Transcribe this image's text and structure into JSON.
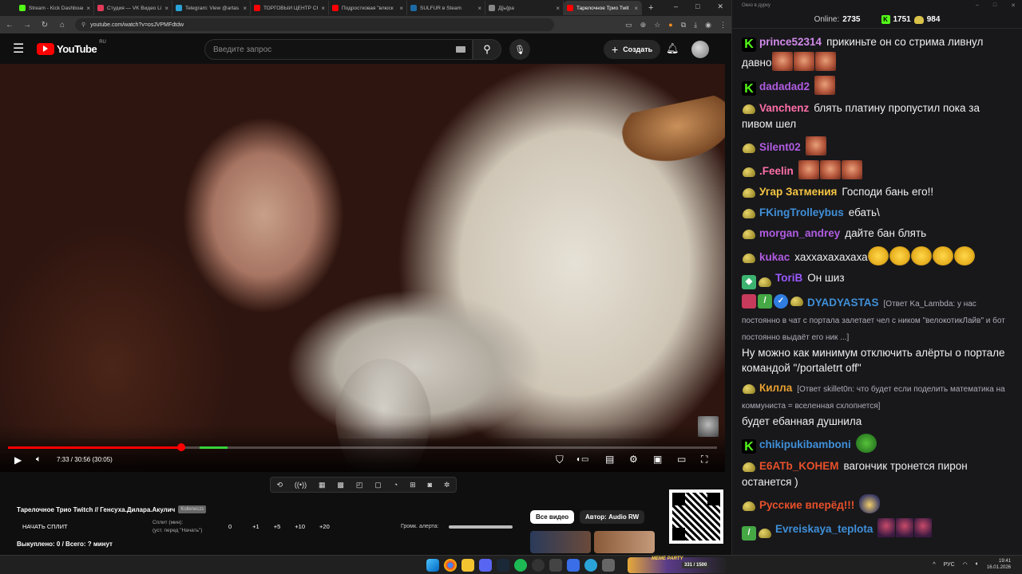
{
  "browser": {
    "tabs": [
      {
        "title": "Stream - Kick Dashboard",
        "color": "#53fc18"
      },
      {
        "title": "Студия — VK Видео Live",
        "color": "#e33a5a"
      },
      {
        "title": "Telegram: View @artas",
        "color": "#2aa3d8"
      },
      {
        "title": "ТОРГОВЫЙ ЦЕНТР СКА",
        "color": "#ff0000"
      },
      {
        "title": "Подростковая \"влюск",
        "color": "#ff0000"
      },
      {
        "title": "SULFUR в Steam",
        "color": "#1b6aa5"
      },
      {
        "title": "Д[ы]ра",
        "color": "#888888"
      },
      {
        "title": "Тарелочное Трио Twit",
        "color": "#ff0000",
        "active": true
      }
    ],
    "url": "youtube.com/watch?v=osJVPMFdtdw"
  },
  "youtube": {
    "logo_text": "YouTube",
    "region": "RU",
    "search_placeholder": "Введите запрос",
    "create_label": "Создать",
    "player": {
      "time": "7:33 / 30:56 (30:05)",
      "progress_fraction": 0.244,
      "buffered_start": 0.27,
      "buffered_end": 0.31
    },
    "video_title": "Тарелочное Трио Twitch // Генсуха.Дилара.Акулич",
    "title_tag": "Kolleneczs",
    "split_button": "НАЧАТЬ СПЛИТ",
    "split_label_1": "Сплит (мин):",
    "split_label_2": "(уст. перед \"Начать\")",
    "split_values": [
      "0",
      "+1",
      "+5",
      "+10",
      "+20"
    ],
    "alert_volume_label": "Громк. алерта:",
    "bought_text": "Выкуплено: 0 / Всего: ? минут",
    "chip_all": "Все видео",
    "chip_author": "Автор: Audio RW"
  },
  "chat": {
    "window_title": "Окно в дурку",
    "online_label": "Online:",
    "online_count": "2735",
    "kick_count": "1751",
    "twitch_count": "984",
    "messages": [
      {
        "badges": [
          "kick"
        ],
        "user": "prince52314",
        "color": "#d08ae8",
        "text": "прикиньте он со стрима ливнул давно",
        "emotes": [
          "face",
          "face",
          "face"
        ]
      },
      {
        "badges": [
          "kick"
        ],
        "user": "dadadad2",
        "color": "#b05ce0",
        "text": "",
        "emotes": [
          "face"
        ]
      },
      {
        "badges": [
          "toad"
        ],
        "user": "Vanchenz",
        "color": "#ff6fa8",
        "text": "блять платину пропустил пока за пивом шел",
        "emotes": []
      },
      {
        "badges": [
          "toad"
        ],
        "user": "Silent02",
        "color": "#b05ce0",
        "text": "",
        "emotes": [
          "face"
        ]
      },
      {
        "badges": [
          "toad"
        ],
        "user": ".Feelin",
        "color": "#ff6fa8",
        "text": "",
        "emotes": [
          "face",
          "face",
          "face"
        ]
      },
      {
        "badges": [
          "toad"
        ],
        "user": "Угар Затмения",
        "color": "#f5c542",
        "text": "Господи бань его!!",
        "emotes": []
      },
      {
        "badges": [
          "toad"
        ],
        "user": "FKingTrolleybus",
        "color": "#3f8fd8",
        "text": "ебать\\",
        "emotes": []
      },
      {
        "badges": [
          "toad"
        ],
        "user": "morgan_andrey",
        "color": "#b05ce0",
        "text": "дайте бан блять",
        "emotes": []
      },
      {
        "badges": [
          "toad"
        ],
        "user": "kukac",
        "color": "#b05ce0",
        "text": "хаххахахахаха",
        "emotes": [
          "laugh",
          "laugh",
          "laugh",
          "laugh",
          "laugh"
        ]
      },
      {
        "badges": [
          "shield",
          "toad"
        ],
        "user": "ToriB",
        "color": "#9b59ff",
        "text": "Он шиз",
        "emotes": []
      },
      {
        "badges": [
          "sub",
          "sword",
          "verif",
          "toad"
        ],
        "user": "DYADYASTAS",
        "color": "#3f8fd8",
        "reply": "[Ответ Ka_Lambda: у нас постоянно в чат с портала залетает чел с ником \"велокотикЛайв\" и бот постоянно выдаёт его ник ...]",
        "text": "Ну можно как минимум отключить алёрты о портале командой \"/portaletrt off\"",
        "emotes": []
      },
      {
        "badges": [
          "toad"
        ],
        "user": "Килла",
        "color": "#e8a030",
        "reply": "[Ответ skillet0n: что будет если поделить математика на коммуниста = вселенная схлопнется]",
        "text": "будет ебанная душнила",
        "emotes": []
      },
      {
        "badges": [
          "kick"
        ],
        "user": "chikipukibamboni",
        "color": "#3f8fd8",
        "text": "",
        "emotes": [
          "pepe"
        ]
      },
      {
        "badges": [
          "toad"
        ],
        "user": "E6ATb_KOHEM",
        "color": "#e8502a",
        "text": "вагончик тронется пирон останется )",
        "emotes": []
      },
      {
        "badges": [
          "toad"
        ],
        "user": "Русские вперёд!!!",
        "color": "#e8502a",
        "text": "",
        "emotes": [
          "cat"
        ]
      },
      {
        "badges": [
          "sword",
          "toad"
        ],
        "user": "Evreiskaya_teplota",
        "color": "#3f8fd8",
        "text": "",
        "emotes": [
          "char",
          "char",
          "char"
        ]
      }
    ]
  },
  "taskbar": {
    "widget_label": "MEME PARTY",
    "widget_count": "331 / 1500",
    "lang": "РУС",
    "time": "19:41",
    "date": "16.01.2026"
  }
}
